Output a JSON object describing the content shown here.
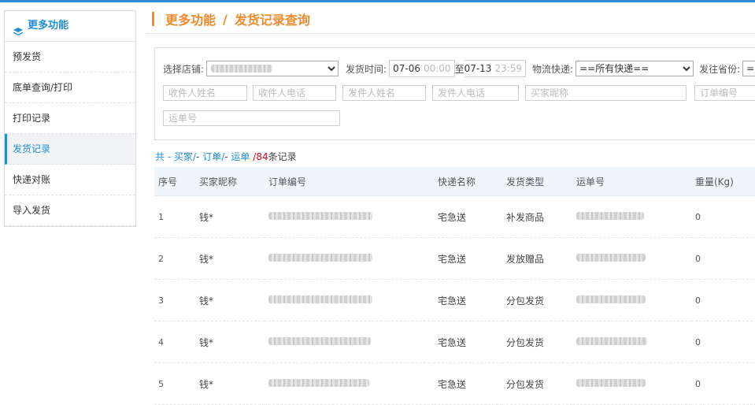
{
  "sidebar": {
    "title": "更多功能",
    "items": [
      {
        "label": "预发货",
        "active": false
      },
      {
        "label": "底单查询/打印",
        "active": false
      },
      {
        "label": "打印记录",
        "active": false
      },
      {
        "label": "发货记录",
        "active": true
      },
      {
        "label": "快递对账",
        "active": false
      },
      {
        "label": "导入发货",
        "active": false
      }
    ]
  },
  "breadcrumb": {
    "section": "更多功能",
    "separator": "/",
    "page": "发货记录查询"
  },
  "filters": {
    "shop_label": "选择店铺:",
    "time_label": "发货时间:",
    "time_start_date": "07-06",
    "time_start_clock": "00:00",
    "time_to": "至",
    "time_end_date": "07-13",
    "time_end_clock": "23:59",
    "express_label": "物流快递:",
    "express_selected": "==所有快递==",
    "province_label": "发往省份:",
    "province_selected": "==",
    "placeholders": {
      "receiver_name": "收件人姓名",
      "receiver_phone": "收件人电话",
      "sender_name": "发件人姓名",
      "sender_phone": "发件人电话",
      "buyer_nick": "买家昵称",
      "order_no": "订单编号",
      "waybill_no": "运单号"
    }
  },
  "summary": {
    "prefix": "共 -",
    "buyer": "买家/",
    "dash1": "-",
    "order": "订单/",
    "dash2": "-",
    "waybill": "运单",
    "slash": "/",
    "count": "84",
    "suffix": "条记录"
  },
  "table": {
    "columns": [
      "序号",
      "买家昵称",
      "订单编号",
      "快递名称",
      "发货类型",
      "运单号",
      "重量(Kg)"
    ],
    "rows": [
      {
        "index": "1",
        "buyer": "钱*",
        "express": "宅急送",
        "type": "补发商品",
        "weight": "0"
      },
      {
        "index": "2",
        "buyer": "钱*",
        "express": "宅急送",
        "type": "发放赠品",
        "weight": "0"
      },
      {
        "index": "3",
        "buyer": "钱*",
        "express": "宅急送",
        "type": "分包发货",
        "weight": "0"
      },
      {
        "index": "4",
        "buyer": "钱*",
        "express": "宅急送",
        "type": "分包发货",
        "weight": "0"
      },
      {
        "index": "5",
        "buyer": "钱*",
        "express": "宅急送",
        "type": "分包发货",
        "weight": "0"
      }
    ]
  },
  "colors": {
    "accent_blue": "#1f8fd8",
    "title_orange": "#f08a2c",
    "count_red": "#d9001b"
  }
}
